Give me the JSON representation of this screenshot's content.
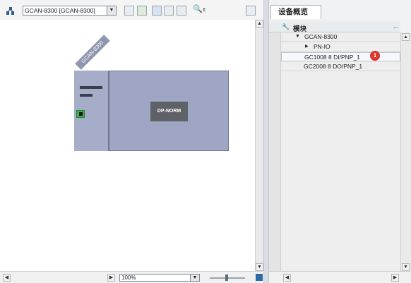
{
  "toolbar": {
    "device_select": "GCAN-8300 [GCAN-8300]",
    "zoom_icon": "zoom-in-icon"
  },
  "canvas": {
    "rack_name": "GCAN-8300",
    "module_label": "DP-NORM"
  },
  "bottom_bar": {
    "zoom_value": "100%"
  },
  "right_panel": {
    "tab_title": "设备概览",
    "column_header": "模块",
    "column_more": "...",
    "rows": [
      {
        "label": "GCAN-8300",
        "expander": "▼"
      },
      {
        "label": "PN-IO",
        "expander": "▶"
      },
      {
        "label": "GC1008 8 DI/PNP_1",
        "selected": true
      },
      {
        "label": "GC2008 8 DO/PNP_1"
      }
    ],
    "badge": "1"
  },
  "colors": {
    "rack": "#9fa6c3",
    "module": "#5e6166",
    "port": "#3fb24a",
    "badge": "#e0332b"
  }
}
